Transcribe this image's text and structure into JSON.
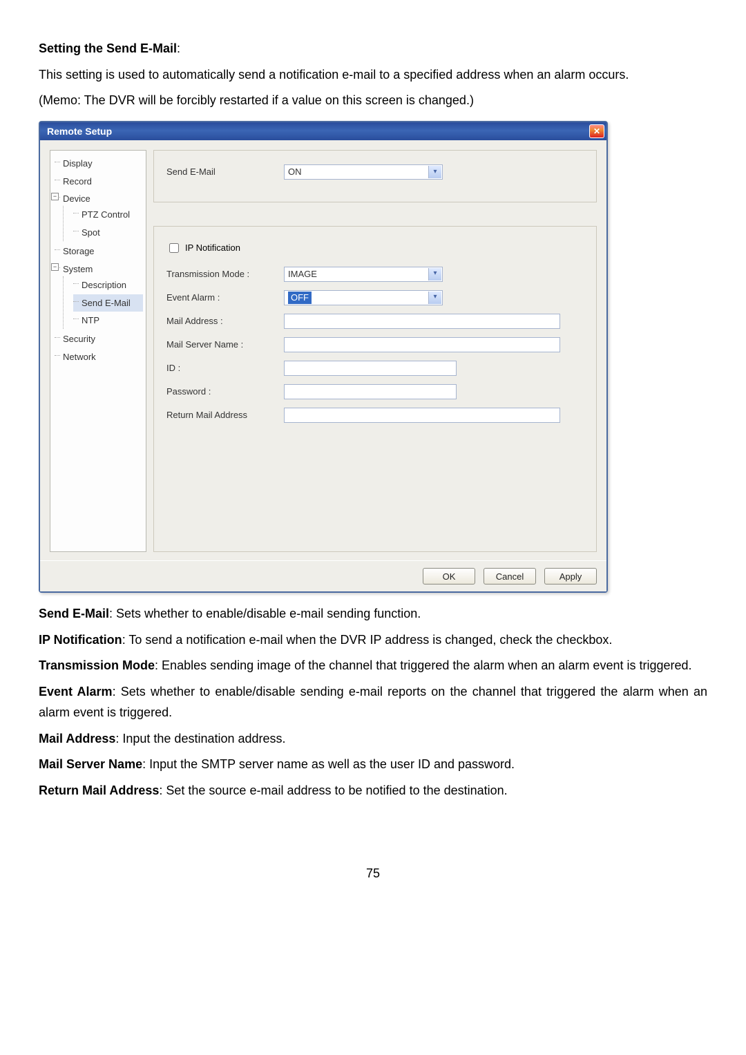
{
  "heading": "Setting the Send E-Mail",
  "colon": ":",
  "intro1": "This setting is used to automatically send a notification e-mail to a specified address when an alarm occurs.",
  "intro2": "(Memo: The DVR will be forcibly restarted if a value on this screen is changed.)",
  "dialog": {
    "title": "Remote Setup",
    "close_icon": "✕",
    "tree": {
      "display": "Display",
      "record": "Record",
      "device": "Device",
      "ptz": "PTZ Control",
      "spot": "Spot",
      "storage": "Storage",
      "system": "System",
      "description": "Description",
      "send_email": "Send E-Mail",
      "ntp": "NTP",
      "security": "Security",
      "network": "Network"
    },
    "form": {
      "send_email_label": "Send E-Mail",
      "send_email_value": "ON",
      "ip_notification": "IP Notification",
      "transmission_mode_label": "Transmission Mode :",
      "transmission_mode_value": "IMAGE",
      "event_alarm_label": "Event Alarm :",
      "event_alarm_value": "OFF",
      "mail_address_label": "Mail Address :",
      "mail_server_label": "Mail Server Name :",
      "id_label": "ID :",
      "password_label": "Password :",
      "return_mail_label": "Return Mail Address"
    },
    "buttons": {
      "ok": "OK",
      "cancel": "Cancel",
      "apply": "Apply"
    }
  },
  "descriptions": {
    "send_email_t": "Send E-Mail",
    "send_email_d": ": Sets whether to enable/disable e-mail sending function.",
    "ip_notif_t": "IP Notification",
    "ip_notif_d": ": To send a notification e-mail when the DVR IP address is changed, check the checkbox.",
    "trans_t": "Transmission Mode",
    "trans_d": ": Enables sending image of the channel that triggered the alarm when an alarm event is triggered.",
    "event_t": "Event Alarm",
    "event_d": ": Sets whether to enable/disable sending e-mail reports on the channel that triggered the alarm when an alarm event is triggered.",
    "mail_addr_t": "Mail Address",
    "mail_addr_d": ": Input the destination address.",
    "mail_srv_t": "Mail Server Name",
    "mail_srv_d": ": Input the SMTP server name as well as the user ID and password.",
    "return_t": "Return Mail Address",
    "return_d": ": Set the source e-mail address to be notified to the destination."
  },
  "page_number": "75"
}
